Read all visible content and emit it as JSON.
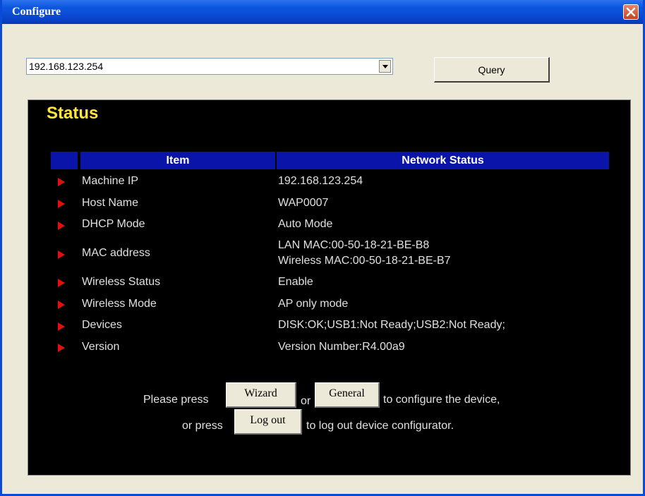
{
  "window": {
    "title": "Configure"
  },
  "toolbar": {
    "ip_selected": "192.168.123.254",
    "query_label": "Query"
  },
  "panel": {
    "title": "Status",
    "headers": {
      "item": "Item",
      "status": "Network Status"
    },
    "rows": [
      {
        "item": "Machine IP",
        "value": "192.168.123.254"
      },
      {
        "item": "Host Name",
        "value": "WAP0007"
      },
      {
        "item": "DHCP Mode",
        "value": "Auto Mode"
      },
      {
        "item": "MAC address",
        "value": "LAN MAC:00-50-18-21-BE-B8",
        "value2": "Wireless MAC:00-50-18-21-BE-B7"
      },
      {
        "item": "Wireless Status",
        "value": "Enable"
      },
      {
        "item": "Wireless Mode",
        "value": "AP only mode"
      },
      {
        "item": "Devices",
        "value": "DISK:OK;USB1:Not Ready;USB2:Not Ready;"
      },
      {
        "item": "Version",
        "value": "Version Number:R4.00a9"
      }
    ],
    "message": {
      "please_press": "Please press",
      "wizard_label": "Wizard",
      "or": "or",
      "general_label": "General",
      "configure_text": "to configure the device,",
      "or_press": "or press",
      "logout_label": "Log out",
      "logout_text": "to log out device configurator."
    }
  },
  "colors": {
    "panel_bg": "#000000",
    "title_yellow": "#ffe53a",
    "header_blue": "#0a14a8",
    "arrow_red": "#e01010",
    "titlebar_blue": "#0a47cf"
  }
}
